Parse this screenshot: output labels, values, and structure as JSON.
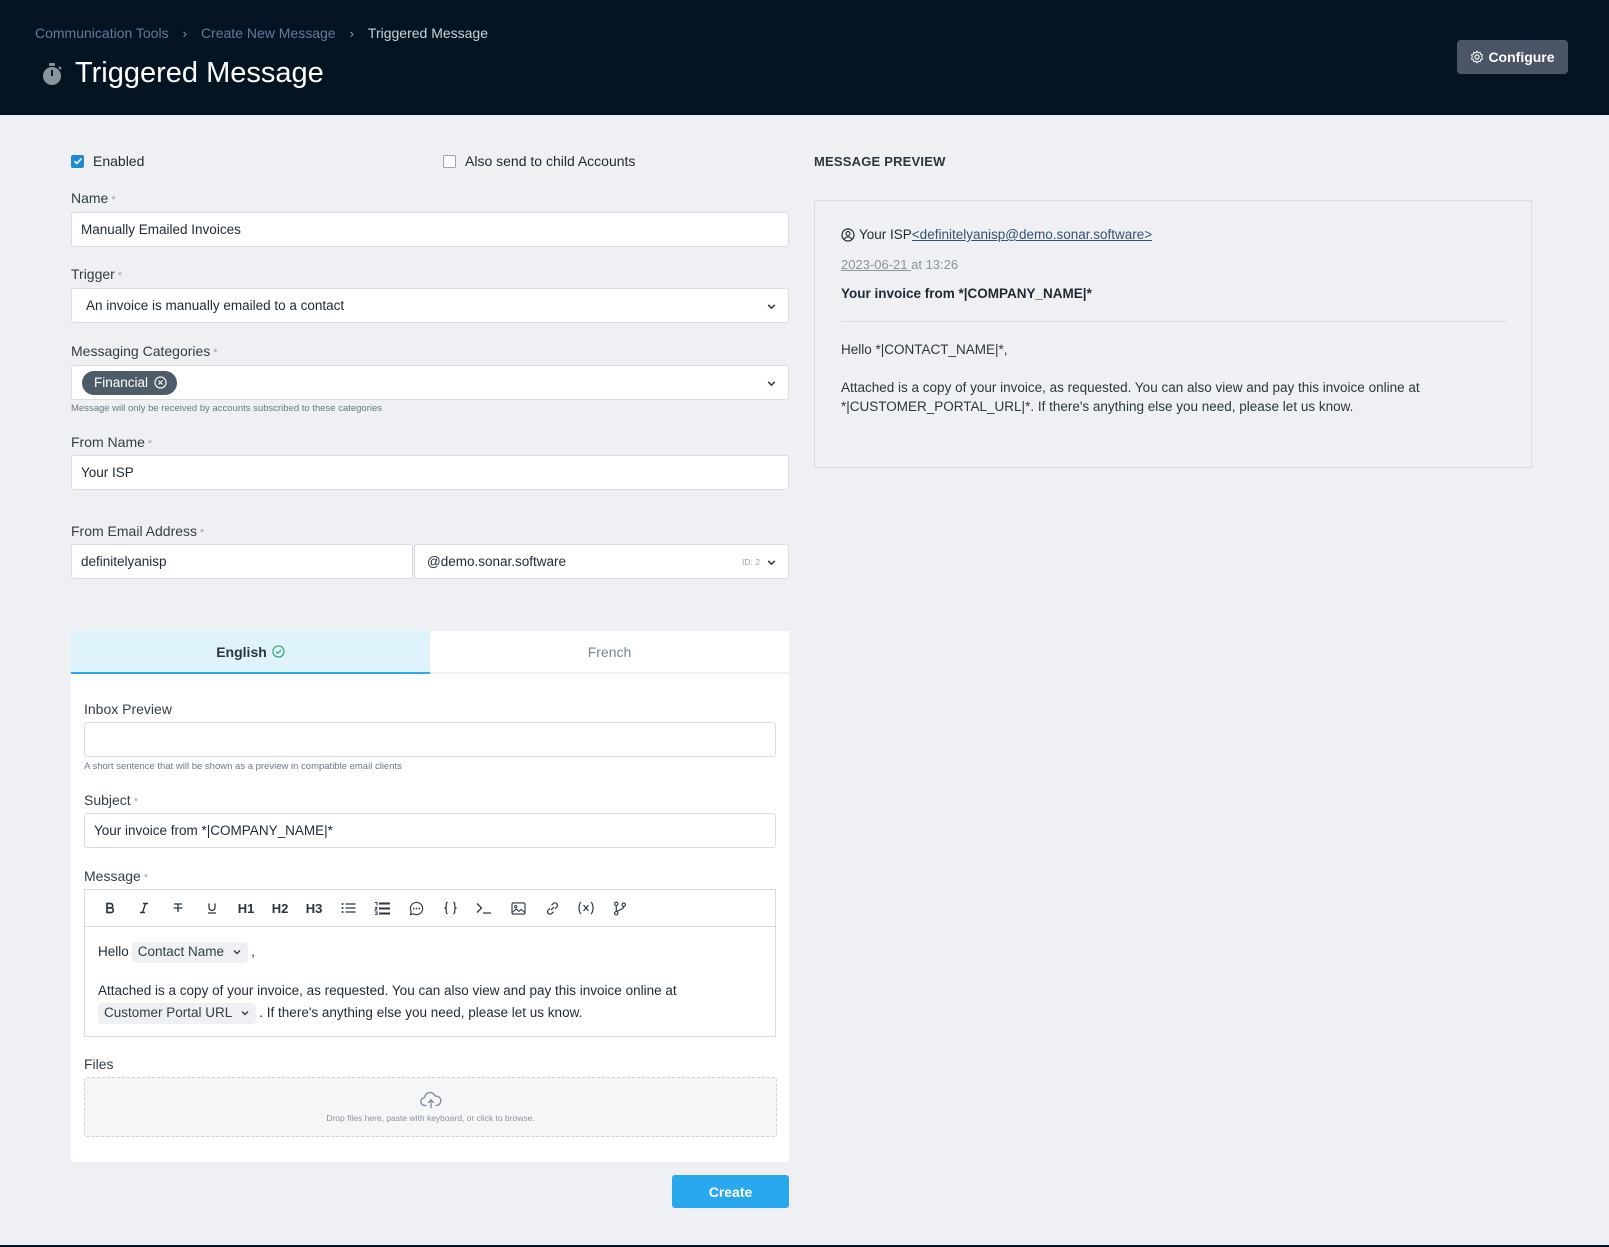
{
  "header": {
    "breadcrumbs": [
      "Communication Tools",
      "Create New Message",
      "Triggered Message"
    ],
    "title": "Triggered Message",
    "configure_label": "Configure"
  },
  "form": {
    "enabled_label": "Enabled",
    "enabled_checked": true,
    "child_accounts_label": "Also send to child Accounts",
    "child_accounts_checked": false,
    "name_label": "Name",
    "name_value": "Manually Emailed Invoices",
    "trigger_label": "Trigger",
    "trigger_value": "An invoice is manually emailed to a contact",
    "categories_label": "Messaging Categories",
    "categories": [
      "Financial"
    ],
    "categories_hint": "Message will only be received by accounts subscribed to these categories",
    "from_name_label": "From Name",
    "from_name_value": "Your ISP",
    "from_email_label": "From Email Address",
    "from_email_user": "definitelyanisp",
    "from_email_domain": "@demo.sonar.software",
    "from_email_domain_id": "ID: 2",
    "required_mark": "*"
  },
  "tabs": [
    {
      "label": "English",
      "active": true
    },
    {
      "label": "French",
      "active": false
    }
  ],
  "content": {
    "inbox_preview_label": "Inbox Preview",
    "inbox_preview_value": "",
    "inbox_preview_hint": "A short sentence that will be shown as a preview in compatible email clients",
    "subject_label": "Subject",
    "subject_value": "Your invoice from *|COMPANY_NAME|*",
    "message_label": "Message",
    "toolbar": [
      "bold-icon",
      "italic-icon",
      "strikethrough-icon",
      "underline-icon",
      "H1",
      "H2",
      "H3",
      "bullet-list-icon",
      "ordered-list-icon",
      "comment-icon",
      "code-braces-icon",
      "terminal-icon",
      "image-icon",
      "link-icon",
      "variable-icon",
      "branch-icon"
    ],
    "body": {
      "hello": "Hello",
      "contact_tag": "Contact Name",
      "comma": ",",
      "line2": "Attached is a copy of your invoice, as requested. You can also view and pay this invoice online at",
      "portal_tag": "Customer Portal URL",
      "line3": ". If there's anything else you need, please let us know."
    },
    "files_label": "Files",
    "dropzone_text": "Drop files here, paste with keyboard, or click to browse."
  },
  "create_label": "Create",
  "preview": {
    "title": "MESSAGE PREVIEW",
    "from_name": "Your ISP",
    "from_email": "<definitelyanisp@demo.sonar.software>",
    "date": "2023-06-21 ",
    "time": "at 13:26",
    "subject": "Your invoice from *|COMPANY_NAME|*",
    "greeting": "Hello *|CONTACT_NAME|*,",
    "body": "Attached is a copy of your invoice, as requested. You can also view and pay this invoice online at *|CUSTOMER_PORTAL_URL|*. If there's anything else you need, please let us know."
  },
  "colors": {
    "header_bg": "#041423",
    "accent": "#29a8ee",
    "chip_bg": "#4e5b68",
    "page_bg": "#eef0f3"
  }
}
